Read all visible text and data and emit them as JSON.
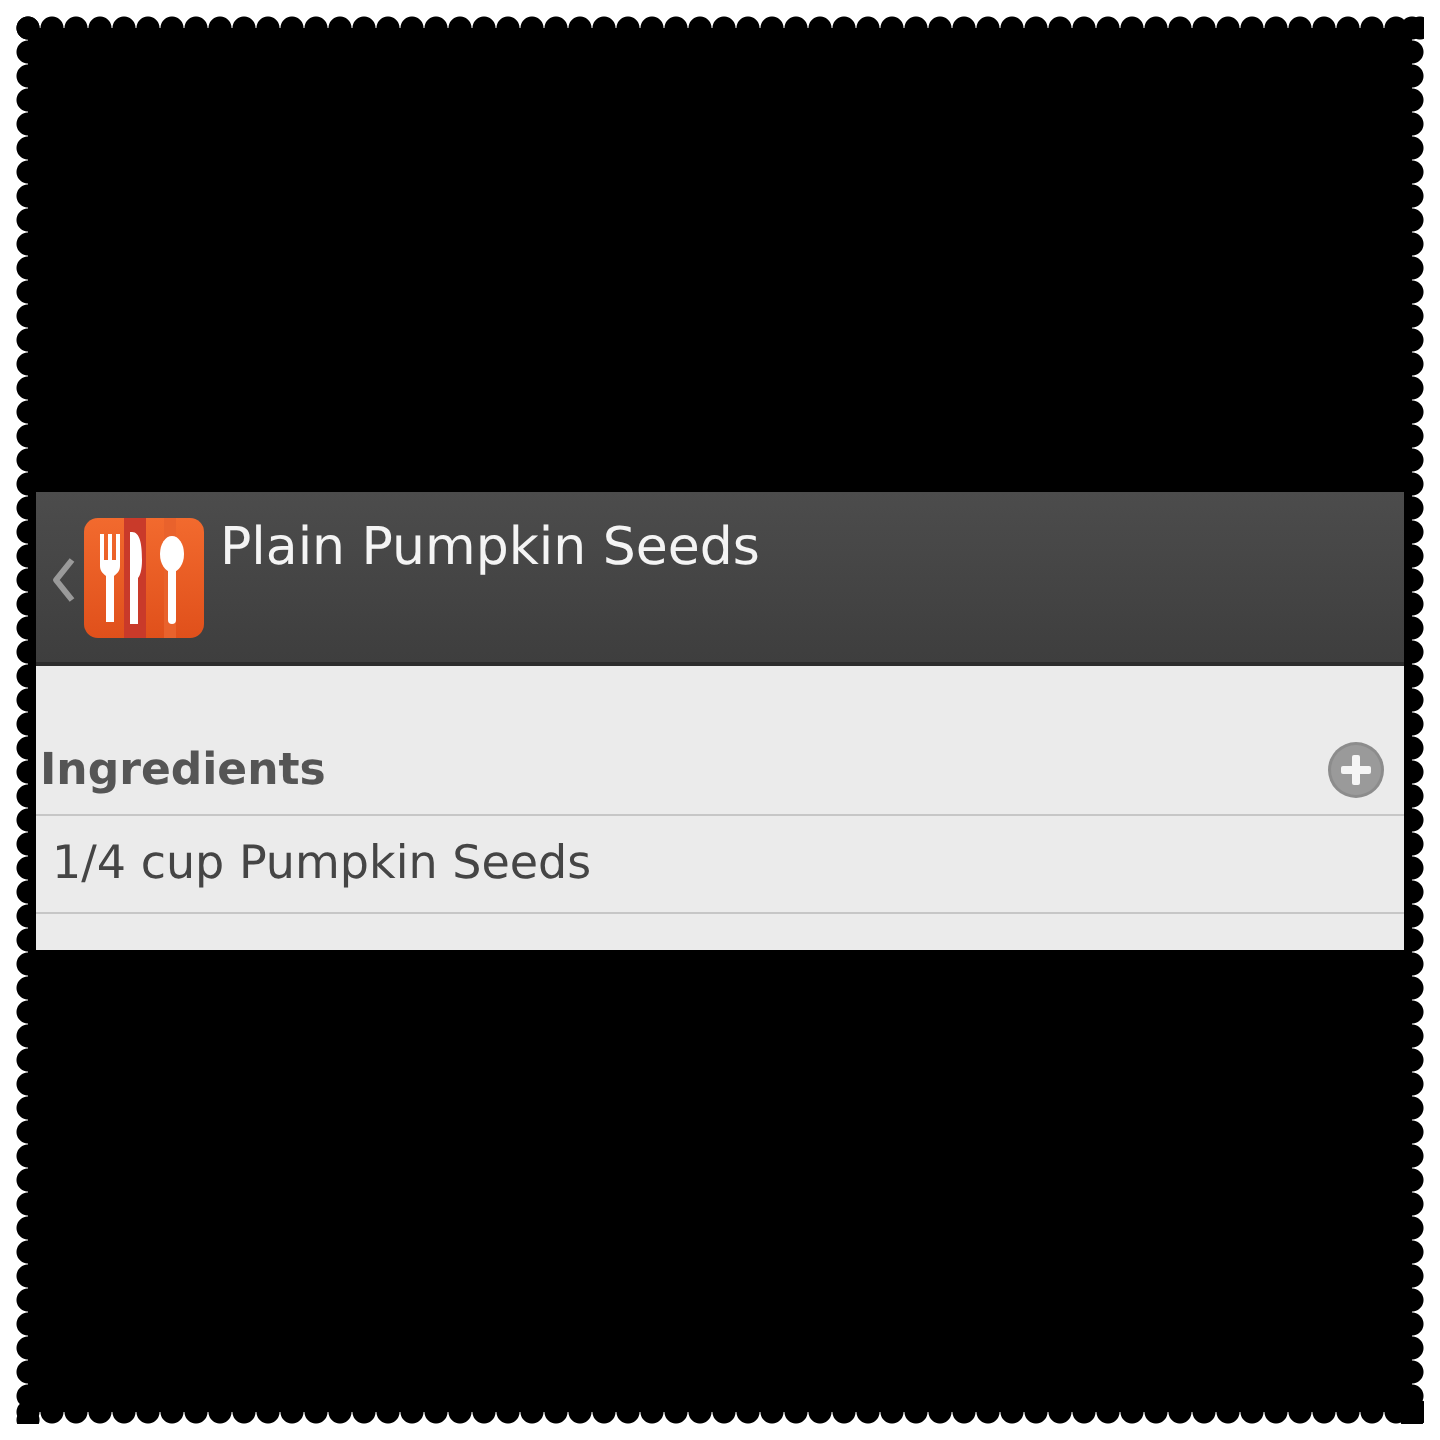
{
  "header": {
    "title": "Plain Pumpkin Seeds"
  },
  "sections": [
    {
      "title": "Ingredients",
      "items": [
        "1/4 cup Pumpkin Seeds"
      ]
    }
  ]
}
